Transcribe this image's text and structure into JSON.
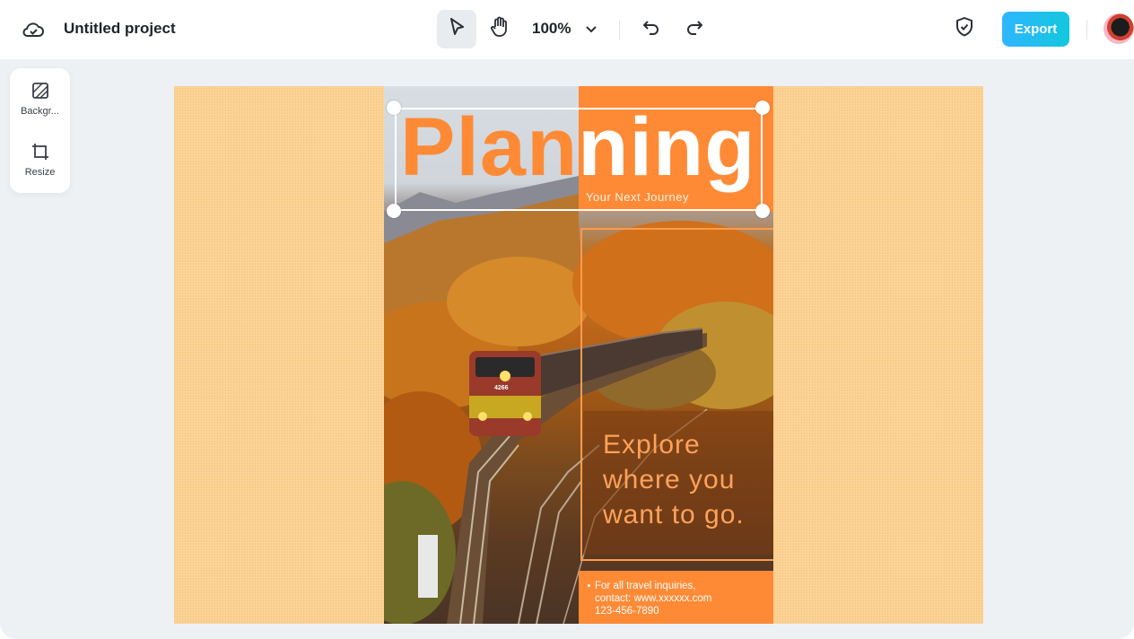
{
  "app": {
    "project_title": "Untitled project",
    "zoom": "100%",
    "export_label": "Export"
  },
  "sidebar": {
    "items": [
      {
        "label": "Backgr...",
        "icon": "background-icon"
      },
      {
        "label": "Resize",
        "icon": "resize-icon"
      }
    ]
  },
  "poster": {
    "headline_a": "Plan",
    "headline_b": "ning",
    "subtitle": "Your Next Journey",
    "tagline_lines": [
      "Explore",
      "where you",
      "want to go."
    ],
    "contact_lines": [
      "For all travel inquiries,",
      "contact: www.xxxxxx.com",
      "123-456-7890"
    ],
    "train_number": "4266"
  },
  "colors": {
    "accent": "#ff8a35",
    "canvas_bg": "#fcd090",
    "export_gradient_start": "#2fb6ff",
    "export_gradient_end": "#13c7dd"
  }
}
